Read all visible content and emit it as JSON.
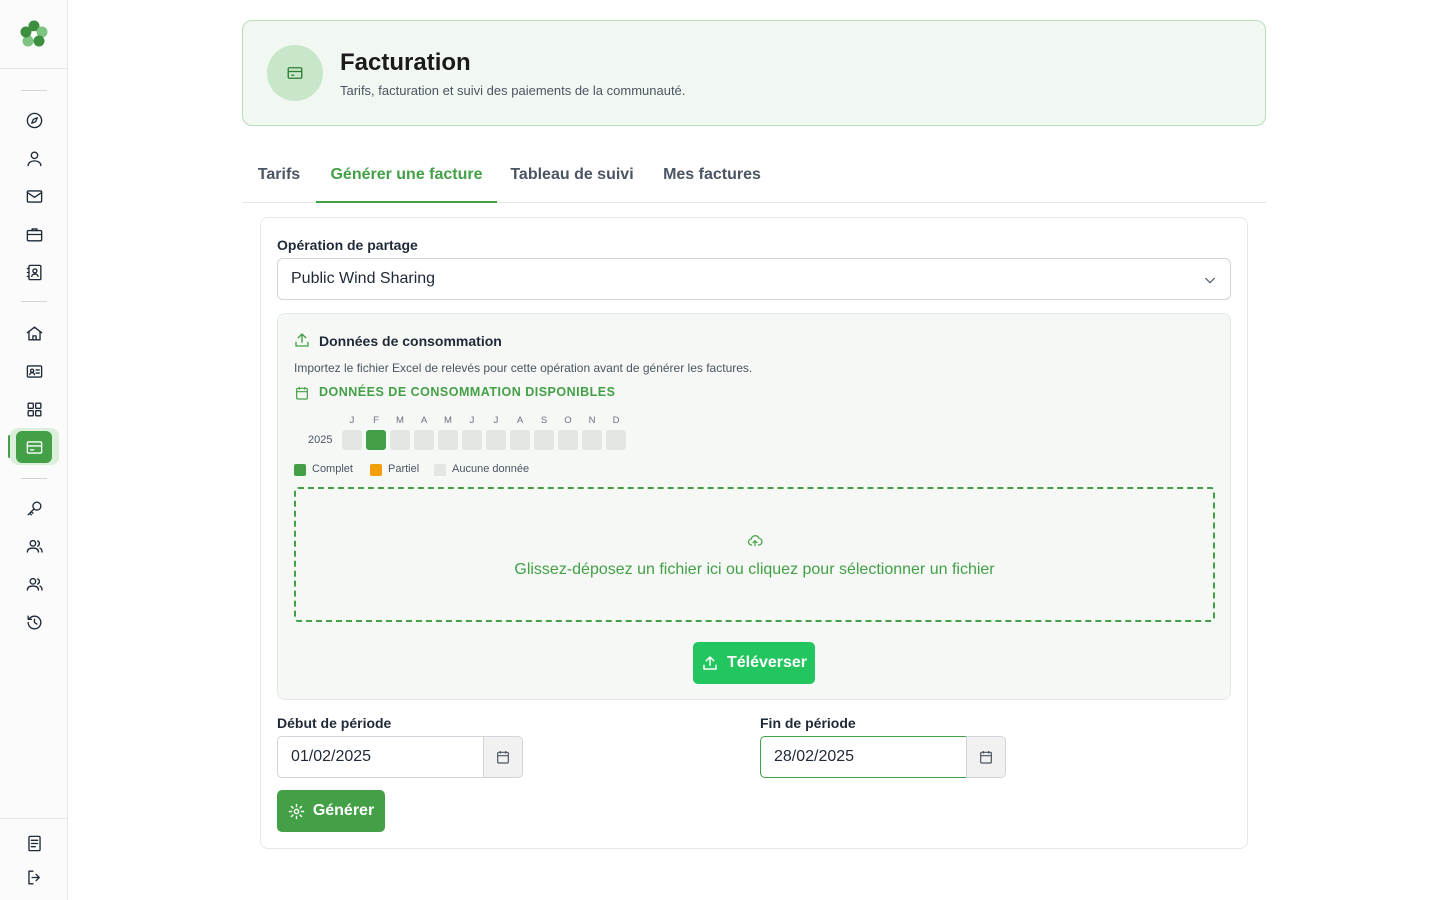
{
  "colors": {
    "accent": "#43a047",
    "upload_button": "#22c55e",
    "header_bg": "#f1f8f1",
    "no_data": "#e3e6e3",
    "partial": "#f59e0b"
  },
  "sidebar": {
    "logo_icon": "clover-logo-icon",
    "items": [
      {
        "icon": "compass-icon"
      },
      {
        "icon": "user-icon"
      },
      {
        "icon": "mail-icon"
      },
      {
        "icon": "briefcase-icon"
      },
      {
        "icon": "contact-card-icon"
      },
      {
        "icon": "home-icon"
      },
      {
        "icon": "id-card-icon"
      },
      {
        "icon": "grid-icon"
      },
      {
        "icon": "credit-card-icon",
        "active": true
      },
      {
        "icon": "key-icon"
      },
      {
        "icon": "users-icon"
      },
      {
        "icon": "users-alt-icon"
      },
      {
        "icon": "history-icon"
      }
    ],
    "bottom": [
      {
        "icon": "document-icon"
      },
      {
        "icon": "logout-icon"
      }
    ]
  },
  "header": {
    "icon": "credit-card-icon",
    "title": "Facturation",
    "subtitle": "Tarifs, facturation et suivi des paiements de la communauté."
  },
  "tabs": [
    {
      "label": "Tarifs"
    },
    {
      "label": "Générer une facture",
      "active": true
    },
    {
      "label": "Tableau de suivi"
    },
    {
      "label": "Mes factures"
    }
  ],
  "form": {
    "operation_label": "Opération de partage",
    "operation_value": "Public Wind Sharing",
    "consumption": {
      "title": "Données de consommation",
      "description": "Importez le fichier Excel de relevés pour cette opération avant de générer les factures.",
      "available_title": "DONNÉES DE CONSOMMATION DISPONIBLES",
      "year": "2025",
      "months": [
        "J",
        "F",
        "M",
        "A",
        "M",
        "J",
        "J",
        "A",
        "S",
        "O",
        "N",
        "D"
      ],
      "status": [
        "none",
        "complete",
        "none",
        "none",
        "none",
        "none",
        "none",
        "none",
        "none",
        "none",
        "none",
        "none"
      ],
      "legend": {
        "complete": "Complet",
        "partial": "Partiel",
        "none": "Aucune donnée"
      },
      "dropzone_text": "Glissez-déposez un fichier ici ou cliquez pour sélectionner un fichier",
      "upload_label": "Téléverser"
    },
    "start_label": "Début de période",
    "start_value": "01/02/2025",
    "end_label": "Fin de période",
    "end_value": "28/02/2025",
    "generate_label": "Générer"
  }
}
